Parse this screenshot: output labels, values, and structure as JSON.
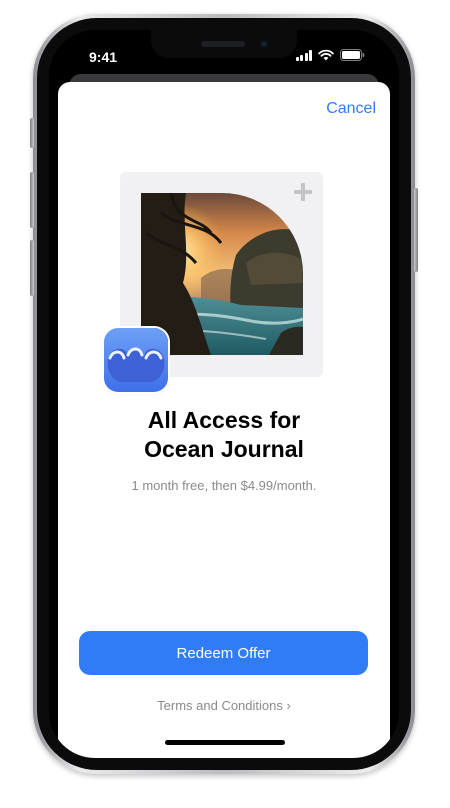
{
  "status_bar": {
    "time": "9:41",
    "icons": [
      "cellular-signal-icon",
      "wifi-icon",
      "battery-icon"
    ]
  },
  "sheet": {
    "cancel_label": "Cancel"
  },
  "offer": {
    "title_line1": "All Access for",
    "title_line2": "Ocean Journal",
    "subtitle": "1 month free, then $4.99/month.",
    "redeem_label": "Redeem Offer",
    "terms_label": "Terms and Conditions",
    "terms_chevron": "›"
  },
  "colors": {
    "accent": "#2f7cf6",
    "secondary_text": "#8a8a8e",
    "app_icon": "#4a7df0"
  }
}
